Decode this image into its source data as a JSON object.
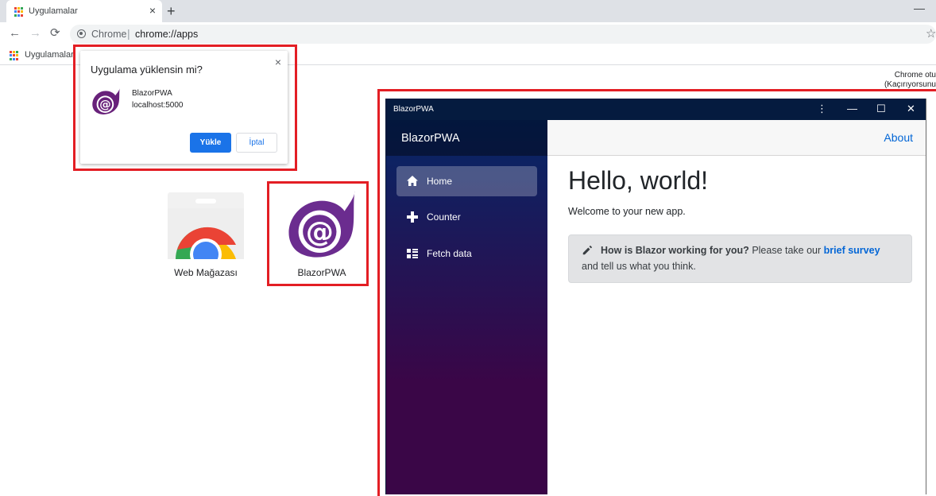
{
  "browser": {
    "tab_title": "Uygulamalar",
    "tab_close": "×",
    "new_tab": "+",
    "window_minimize": "—",
    "nav": {
      "back": "←",
      "forward": "→",
      "reload": "⟳"
    },
    "omnibox": {
      "site_label": "Chrome",
      "separator": "|",
      "url": "chrome://apps"
    },
    "star": "☆",
    "bookmarks": [
      {
        "label": "Uygulamalar"
      }
    ],
    "signin_text_line1": "Chrome otu",
    "signin_text_line2": "(Kaçırıyorsunu",
    "favicon_colors": [
      "#ea4335",
      "#fbbc04",
      "#34a853",
      "#4285f4",
      "#ea4335",
      "#fbbc04",
      "#34a853",
      "#4285f4",
      "#ea4335"
    ]
  },
  "install_dialog": {
    "title": "Uygulama yüklensin mi?",
    "close": "×",
    "app_name": "BlazorPWA",
    "app_origin": "localhost:5000",
    "install_label": "Yükle",
    "cancel_label": "İptal"
  },
  "apps": [
    {
      "label": "Web Mağazası",
      "icon": "chrome-web-store-icon"
    },
    {
      "label": "BlazorPWA",
      "icon": "blazor-icon"
    }
  ],
  "pwa_window": {
    "title": "BlazorPWA",
    "controls": {
      "menu": "⋮",
      "minimize": "—",
      "maximize": "☐",
      "close": "✕"
    },
    "brand": "BlazorPWA",
    "nav": [
      {
        "label": "Home",
        "icon": "home-icon",
        "active": true
      },
      {
        "label": "Counter",
        "icon": "plus-icon",
        "active": false
      },
      {
        "label": "Fetch data",
        "icon": "list-icon",
        "active": false
      }
    ],
    "top_link": "About",
    "heading": "Hello, world!",
    "welcome": "Welcome to your new app.",
    "survey": {
      "question": "How is Blazor working for you?",
      "prefix": "Please take our",
      "link": "brief survey",
      "suffix": "and tell us what you think."
    },
    "colors": {
      "titlebar": "#051b3f",
      "sidebar_top": "#052767",
      "sidebar_bottom": "#3a0647",
      "link": "#0366d6"
    }
  }
}
